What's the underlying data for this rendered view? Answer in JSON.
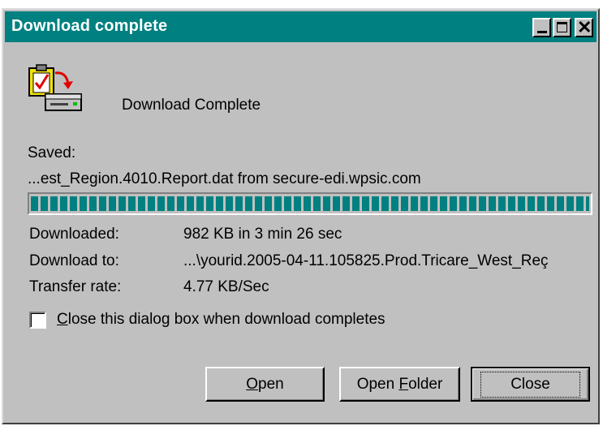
{
  "window": {
    "title": "Download complete",
    "controls": {
      "minimize": "minimize-icon",
      "maximize": "maximize-icon",
      "close": "close-icon"
    }
  },
  "header": {
    "icon": "download-complete-icon",
    "text": "Download Complete"
  },
  "saved": {
    "label": "Saved:",
    "value": "...est_Region.4010.Report.dat from secure-edi.wpsic.com"
  },
  "progress": {
    "percent": 100
  },
  "details": {
    "downloaded": {
      "label": "Downloaded:",
      "value": "982 KB in 3 min 26 sec"
    },
    "download_to": {
      "label": "Download to:",
      "value": "...\\yourid.2005-04-11.105825.Prod.Tricare_West_Reç"
    },
    "transfer_rate": {
      "label": "Transfer rate:",
      "value": "4.77 KB/Sec"
    }
  },
  "checkbox": {
    "label_first": "C",
    "label_rest": "lose this dialog box when download completes",
    "checked": false
  },
  "buttons": {
    "open_first": "O",
    "open_rest": "pen",
    "open_folder_pre": "Open ",
    "open_folder_key": "F",
    "open_folder_rest": "older",
    "close": "Close"
  },
  "colors": {
    "titlebar": "#008080",
    "face": "#c0c0c0",
    "progress": "#008080"
  }
}
